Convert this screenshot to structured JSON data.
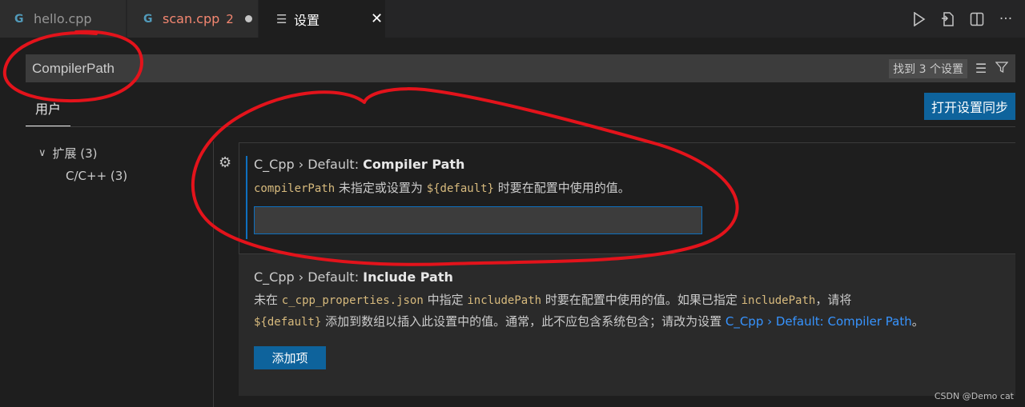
{
  "tabs": [
    {
      "label": "hello.cpp",
      "icon": "cpp-file-icon"
    },
    {
      "label": "scan.cpp",
      "badge": "2",
      "icon": "cpp-file-icon"
    },
    {
      "label": "设置",
      "icon": "settings-file-icon"
    }
  ],
  "tab_icon_glyph": "G",
  "actions": [
    "run-icon",
    "open-settings-json-icon",
    "split-editor-icon",
    "more-icon"
  ],
  "search": {
    "value": "CompilerPath",
    "result_count": "找到 3 个设置"
  },
  "scope_tab": "用户",
  "sync_button": "打开设置同步",
  "toc": {
    "group": "扩展 (3)",
    "item": "C/C++ (3)"
  },
  "settings": [
    {
      "title_prefix": "C_Cpp › Default: ",
      "title_name": "Compiler Path",
      "desc_code1": "compilerPath",
      "desc_text1": " 未指定或设置为 ",
      "desc_code2": "${default}",
      "desc_text2": " 时要在配置中使用的值。",
      "value": ""
    },
    {
      "title_prefix": "C_Cpp › Default: ",
      "title_name": "Include Path",
      "line1_text1": "未在 ",
      "line1_code1": "c_cpp_properties.json",
      "line1_text2": " 中指定 ",
      "line1_code2": "includePath",
      "line1_text3": " 时要在配置中使用的值。如果已指定 ",
      "line1_code3": "includePath",
      "line1_text4": "，请将",
      "line2_code1": "${default}",
      "line2_text1": " 添加到数组以插入此设置中的值。通常，此不应包含系统包含；请改为设置 ",
      "line2_link": "C_Cpp › Default: Compiler Path",
      "line2_text2": "。",
      "add_button": "添加项"
    }
  ],
  "watermark": "CSDN @Demo cat",
  "colors": {
    "annotation": "#e3131b",
    "accent": "#0e639c",
    "code": "#d7ba7d",
    "error_tab": "#f48771"
  }
}
